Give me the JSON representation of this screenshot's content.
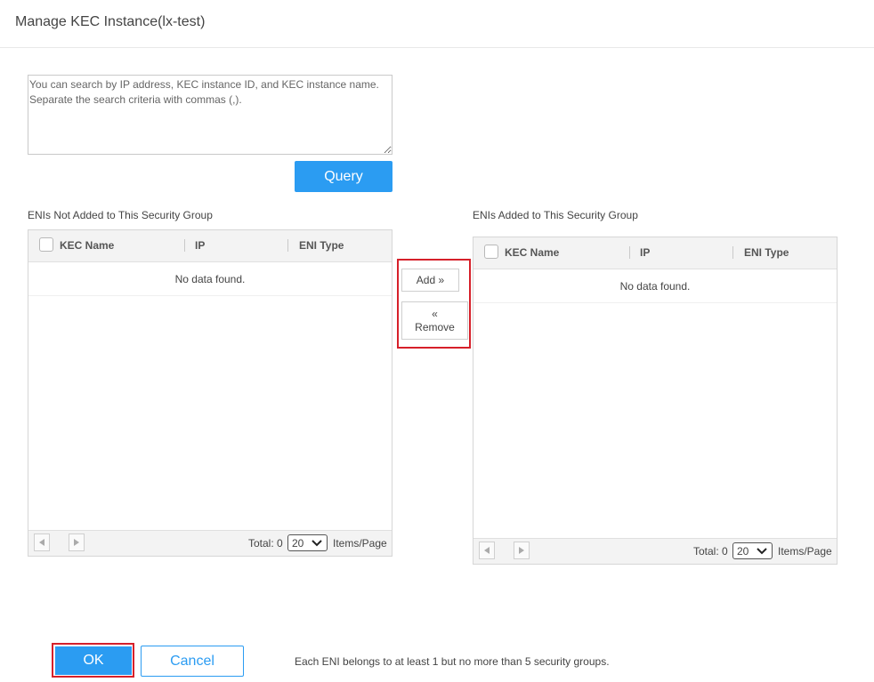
{
  "dialog": {
    "title": "Manage KEC Instance(lx-test)"
  },
  "search": {
    "placeholder": "You can search by IP address, KEC instance ID, and KEC instance name. Separate the search criteria with commas (,).",
    "value": ""
  },
  "query_button": {
    "label": "Query",
    "color": "#2b9cf2"
  },
  "left_panel": {
    "label": "ENIs Not Added to This Security Group",
    "columns": [
      "KEC Name",
      "IP",
      "ENI Type"
    ],
    "empty_text": "No data found.",
    "total_label": "Total: 0",
    "page_size": "20",
    "items_per_page_label": "Items/Page"
  },
  "right_panel": {
    "label": "ENIs Added to This Security Group",
    "columns": [
      "KEC Name",
      "IP",
      "ENI Type"
    ],
    "empty_text": "No data found.",
    "total_label": "Total: 0",
    "page_size": "20",
    "items_per_page_label": "Items/Page"
  },
  "transfer": {
    "add_label": "Add",
    "add_arrow": "»",
    "remove_arrow": "«",
    "remove_label": "Remove"
  },
  "footer": {
    "ok_label": "OK",
    "cancel_label": "Cancel",
    "note": "Each ENI belongs to at least 1 but no more than 5 security groups."
  },
  "colors": {
    "primary": "#2b9cf2",
    "highlight": "#d6202a"
  }
}
